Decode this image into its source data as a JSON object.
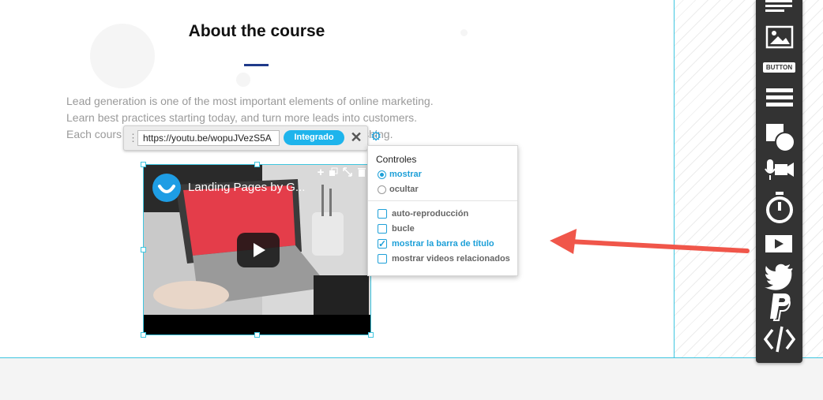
{
  "section": {
    "heading": "About the course",
    "body_lines": [
      "Lead generation is one of the most important elements of online marketing.",
      "Learn best practices starting today, and turn more leads into customers.",
      "Each cours",
      "ishing."
    ]
  },
  "url_toolbar": {
    "url_value": "https://youtu.be/wopuJVezS5A",
    "embed_label": "Integrado",
    "drag_glyph": "⋮",
    "close_glyph": "✕",
    "gear_glyph": "⚙"
  },
  "video": {
    "title": "Landing Pages by G..."
  },
  "settings": {
    "title": "Controles",
    "controls_options": [
      {
        "label": "mostrar",
        "selected": true
      },
      {
        "label": "ocultar",
        "selected": false
      }
    ],
    "checkboxes": [
      {
        "label": "auto-reproducción",
        "checked": false
      },
      {
        "label": "bucle",
        "checked": false
      },
      {
        "label": "mostrar la barra de título",
        "checked": true
      },
      {
        "label": "mostrar videos relacionados",
        "checked": false
      }
    ]
  },
  "right_toolbar": {
    "button_label": "BUTTON",
    "items": [
      "text-icon",
      "image-icon",
      "button-icon",
      "form-icon",
      "shapes-icon",
      "media-icon",
      "timer-icon",
      "video-icon",
      "twitter-icon",
      "paypal-icon",
      "code-icon"
    ]
  },
  "colors": {
    "accent": "#1eb4ec",
    "selection": "#3fc6e0",
    "arrow": "#f0564a",
    "toolbar_bg": "#333333",
    "heading_rule": "#1f3a8a"
  }
}
